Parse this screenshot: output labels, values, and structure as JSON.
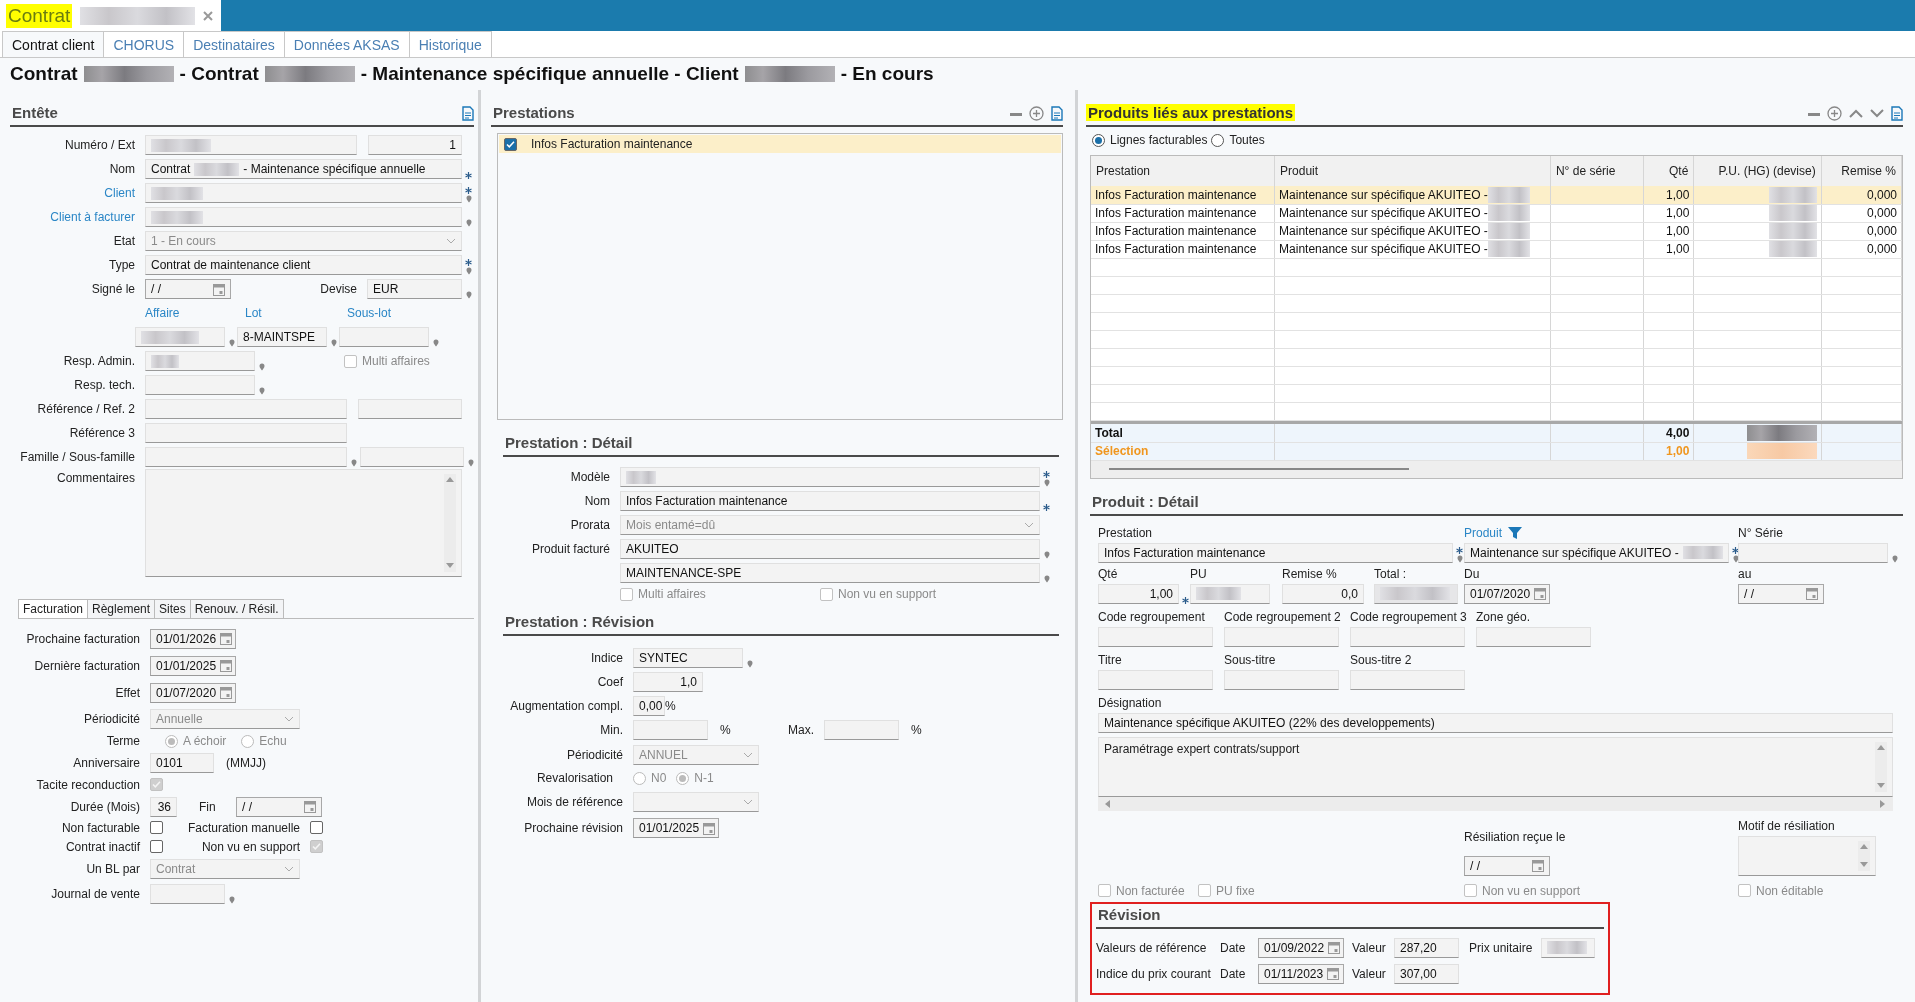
{
  "document_tab": {
    "label": "Contrat"
  },
  "tabs": [
    {
      "label": "Contrat client",
      "selected": true
    },
    {
      "label": "CHORUS",
      "selected": false
    },
    {
      "label": "Destinataires",
      "selected": false
    },
    {
      "label": "Données AKSAS",
      "selected": false
    },
    {
      "label": "Historique",
      "selected": false
    }
  ],
  "title_parts": [
    "Contrat",
    "- Contrat",
    "- Maintenance spécifique annuelle - Client",
    "- En cours"
  ],
  "entete": {
    "title": "Entête",
    "numero": {
      "label": "Numéro / Ext",
      "ext": "1"
    },
    "nom": {
      "label": "Nom",
      "before": "Contrat",
      "after": "- Maintenance spécifique annuelle",
      "required": true
    },
    "client": {
      "label": "Client",
      "required": true
    },
    "client_facturer": {
      "label": "Client à facturer"
    },
    "etat": {
      "label": "Etat",
      "value": "1 - En cours"
    },
    "type": {
      "label": "Type",
      "value": "Contrat de maintenance client",
      "required": true
    },
    "signe": {
      "label": "Signé le",
      "value": "/ /"
    },
    "devise": {
      "label": "Devise",
      "value": "EUR"
    },
    "affaire": {
      "label": "Affaire"
    },
    "lot": {
      "label": "Lot",
      "value": "8-MAINTSPE"
    },
    "sous_lot": {
      "label": "Sous-lot"
    },
    "resp_admin": {
      "label": "Resp. Admin."
    },
    "multi_affaires": {
      "label": "Multi affaires",
      "checked": false,
      "disabled": true
    },
    "resp_tech": {
      "label": "Resp. tech."
    },
    "reference": {
      "label": "Référence / Ref. 2"
    },
    "reference3": {
      "label": "Référence 3"
    },
    "famille": {
      "label": "Famille / Sous-famille"
    },
    "commentaires": {
      "label": "Commentaires"
    }
  },
  "billing_tabs": [
    {
      "label": "Facturation",
      "selected": true
    },
    {
      "label": "Règlement",
      "selected": false
    },
    {
      "label": "Sites",
      "selected": false
    },
    {
      "label": "Renouv. / Résil.",
      "selected": false
    }
  ],
  "billing": {
    "prochaine": {
      "label": "Prochaine facturation",
      "value": "01/01/2026"
    },
    "derniere": {
      "label": "Dernière facturation",
      "value": "01/01/2025"
    },
    "effet": {
      "label": "Effet",
      "value": "01/07/2020"
    },
    "periodicite": {
      "label": "Périodicité",
      "value": "Annuelle"
    },
    "terme": {
      "label": "Terme",
      "disabled": true,
      "options": [
        {
          "label": "A échoir",
          "selected": true
        },
        {
          "label": "Echu",
          "selected": false
        }
      ]
    },
    "anniversaire": {
      "label": "Anniversaire",
      "value": "0101",
      "hint": "(MMJJ)"
    },
    "tacite": {
      "label": "Tacite reconduction",
      "checked": true,
      "disabled": true
    },
    "duree": {
      "label": "Durée (Mois)",
      "value": "36"
    },
    "fin": {
      "label": "Fin",
      "value": "/ /"
    },
    "non_facturable": {
      "label": "Non facturable",
      "checked": false,
      "disabled": false
    },
    "facturation_manuelle": {
      "label": "Facturation manuelle",
      "checked": false,
      "disabled": false
    },
    "contrat_inactif": {
      "label": "Contrat inactif",
      "checked": false,
      "disabled": false
    },
    "non_vu_support": {
      "label": "Non vu en support",
      "checked": true,
      "disabled": true
    },
    "un_bl_par": {
      "label": "Un BL par",
      "value": "Contrat"
    },
    "journal": {
      "label": "Journal de vente"
    }
  },
  "prestations": {
    "title": "Prestations",
    "items": [
      {
        "label": "Infos Facturation maintenance",
        "checked": true,
        "selected": true
      }
    ]
  },
  "prestation_detail": {
    "title": "Prestation : Détail",
    "modele": {
      "label": "Modèle",
      "required": true
    },
    "nom": {
      "label": "Nom",
      "value": "Infos Facturation maintenance",
      "required": true
    },
    "prorata": {
      "label": "Prorata",
      "value": "Mois entamé=dû"
    },
    "produit_facture": {
      "label": "Produit facturé",
      "values": [
        "AKUITEO",
        "MAINTENANCE-SPE"
      ]
    },
    "options": [
      {
        "label": "Multi affaires",
        "checked": false,
        "disabled": true
      },
      {
        "label": "Non vu en support",
        "checked": false,
        "disabled": true
      }
    ]
  },
  "prestation_revision": {
    "title": "Prestation : Révision",
    "indice": {
      "label": "Indice",
      "value": "SYNTEC"
    },
    "coef": {
      "label": "Coef",
      "value": "1,0"
    },
    "augmentation": {
      "label": "Augmentation compl.",
      "value": "0,00",
      "unit": "%"
    },
    "min": {
      "label": "Min.",
      "unit": "%"
    },
    "max": {
      "label": "Max.",
      "unit": "%"
    },
    "periodicite": {
      "label": "Périodicité",
      "value": "ANNUEL"
    },
    "revalorisation": {
      "label": "Revalorisation",
      "disabled": true,
      "options": [
        {
          "label": "N0",
          "selected": false
        },
        {
          "label": "N-1",
          "selected": true
        }
      ]
    },
    "mois_reference": {
      "label": "Mois de référence"
    },
    "prochaine": {
      "label": "Prochaine révision",
      "value": "01/01/2025"
    }
  },
  "products": {
    "title": "Produits liés aux prestations",
    "filters": [
      {
        "label": "Lignes facturables",
        "selected": true
      },
      {
        "label": "Toutes",
        "selected": false
      }
    ],
    "columns": [
      "Prestation",
      "Produit",
      "N° de série",
      "Qté",
      "P.U. (HG) (devise)",
      "Remise %"
    ],
    "rows": [
      {
        "prestation": "Infos Facturation maintenance",
        "produit": "Maintenance sur spécifique AKUITEO -",
        "qte": "1,00",
        "remise": "0,000",
        "selected": true
      },
      {
        "prestation": "Infos Facturation maintenance",
        "produit": "Maintenance sur spécifique AKUITEO -",
        "qte": "1,00",
        "remise": "0,000",
        "selected": false
      },
      {
        "prestation": "Infos Facturation maintenance",
        "produit": "Maintenance sur spécifique AKUITEO -",
        "qte": "1,00",
        "remise": "0,000",
        "selected": false
      },
      {
        "prestation": "Infos Facturation maintenance",
        "produit": "Maintenance sur spécifique AKUITEO -",
        "qte": "1,00",
        "remise": "0,000",
        "selected": false
      }
    ],
    "total": {
      "label": "Total",
      "qte": "4,00"
    },
    "selection": {
      "label": "Sélection",
      "qte": "1,00"
    }
  },
  "product_detail": {
    "title": "Produit : Détail",
    "prestation": {
      "label": "Prestation",
      "value": "Infos Facturation maintenance",
      "required": true
    },
    "produit": {
      "label": "Produit",
      "value": "Maintenance sur spécifique AKUITEO -",
      "required": true
    },
    "serie": {
      "label": "N° Série"
    },
    "qte": {
      "label": "Qté",
      "value": "1,00",
      "required": true
    },
    "pu": {
      "label": "PU"
    },
    "remise": {
      "label": "Remise %",
      "value": "0,0"
    },
    "total": {
      "label": "Total :"
    },
    "du": {
      "label": "Du",
      "value": "01/07/2020"
    },
    "au": {
      "label": "au",
      "value": "/ /"
    },
    "codes": [
      {
        "label": "Code regroupement"
      },
      {
        "label": "Code regroupement 2"
      },
      {
        "label": "Code regroupement 3"
      },
      {
        "label": "Zone géo."
      }
    ],
    "titles": [
      {
        "label": "Titre"
      },
      {
        "label": "Sous-titre"
      },
      {
        "label": "Sous-titre 2"
      }
    ],
    "designation": {
      "label": "Désignation",
      "value": "Maintenance spécifique AKUITEO (22% des developpements)",
      "text": "Paramétrage expert contrats/support"
    },
    "resiliation": {
      "label": "Résiliation reçue le",
      "value": "/ /"
    },
    "motif": {
      "label": "Motif de résiliation"
    },
    "options": [
      {
        "label": "Non facturée",
        "checked": false,
        "disabled": true
      },
      {
        "label": "PU fixe",
        "checked": false,
        "disabled": true
      },
      {
        "label": "Non vu en support",
        "checked": false,
        "disabled": true
      },
      {
        "label": "Non éditable",
        "checked": false,
        "disabled": true
      }
    ]
  },
  "revision": {
    "title": "Révision",
    "rows": [
      {
        "label": "Valeurs de référence",
        "date_label": "Date",
        "date": "01/09/2022",
        "value_label": "Valeur",
        "value": "287,20",
        "price_label": "Prix unitaire"
      },
      {
        "label": "Indice du prix courant",
        "date_label": "Date",
        "date": "01/11/2023",
        "value_label": "Valeur",
        "value": "307,00"
      }
    ]
  }
}
